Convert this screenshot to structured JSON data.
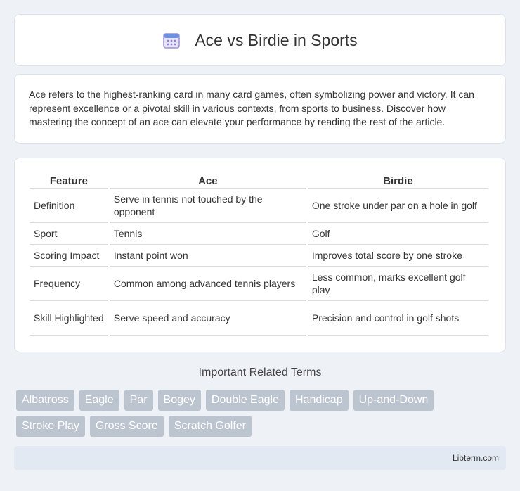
{
  "header": {
    "title": "Ace vs Birdie in Sports",
    "icon": "calendar-icon"
  },
  "intro": {
    "text": "Ace refers to the highest-ranking card in many card games, often symbolizing power and victory. It can represent excellence or a pivotal skill in various contexts, from sports to business. Discover how mastering the concept of an ace can elevate your performance by reading the rest of the article."
  },
  "table": {
    "headers": [
      "Feature",
      "Ace",
      "Birdie"
    ],
    "rows": [
      [
        "Definition",
        "Serve in tennis not touched by the opponent",
        "One stroke under par on a hole in golf"
      ],
      [
        "Sport",
        "Tennis",
        "Golf"
      ],
      [
        "Scoring Impact",
        "Instant point won",
        "Improves total score by one stroke"
      ],
      [
        "Frequency",
        "Common among advanced tennis players",
        "Less common, marks excellent golf play"
      ],
      [
        "Skill Highlighted",
        "Serve speed and accuracy",
        "Precision and control in golf shots"
      ]
    ]
  },
  "related": {
    "title": "Important Related Terms",
    "tags": [
      "Albatross",
      "Eagle",
      "Par",
      "Bogey",
      "Double Eagle",
      "Handicap",
      "Up-and-Down",
      "Stroke Play",
      "Gross Score",
      "Scratch Golfer"
    ]
  },
  "footer": {
    "text": "Libterm.com"
  }
}
